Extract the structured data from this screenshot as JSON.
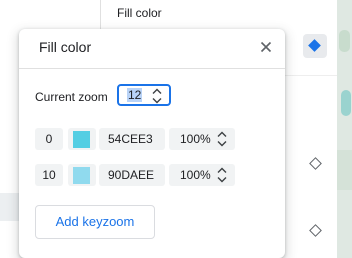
{
  "background": {
    "panel_label": "Fill color"
  },
  "dialog": {
    "title": "Fill color",
    "current_zoom_label": "Current zoom",
    "current_zoom_value": "12",
    "rows": [
      {
        "zoom": "0",
        "color_hex": "54CEE3",
        "swatch_color": "#54CEE3",
        "opacity": "100%"
      },
      {
        "zoom": "10",
        "color_hex": "90DAEE",
        "swatch_color": "#90DAEE",
        "opacity": "100%"
      }
    ],
    "add_button_label": "Add keyzoom"
  },
  "colors": {
    "accent": "#1a73e8",
    "selected_marker": "#1a73e8"
  },
  "icons": {
    "close": "close-icon",
    "stepper": "stepper-icon",
    "active_keyframe": "diamond-filled-icon",
    "keyframe": "diamond-outline-icon",
    "remove": "minus-icon"
  }
}
